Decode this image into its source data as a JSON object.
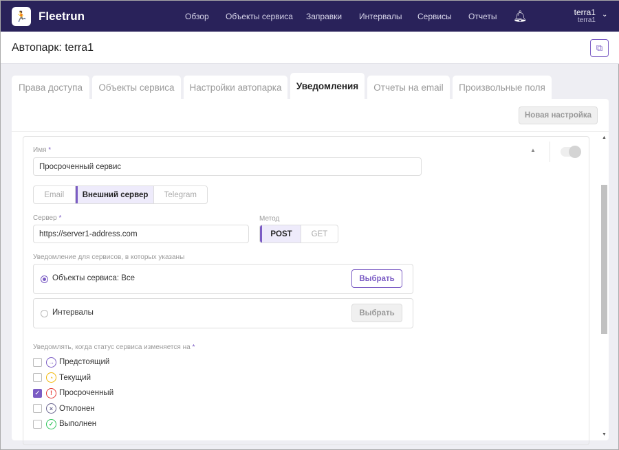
{
  "header": {
    "brand": "Fleetrun",
    "nav": [
      "Обзор",
      "Объекты сервиса",
      "Заправки",
      "Интервалы",
      "Сервисы",
      "Отчеты"
    ],
    "user_name": "terra1",
    "user_sub": "terra1"
  },
  "page_title": "Автопарк: terra1",
  "tabs": [
    "Права доступа",
    "Объекты сервиса",
    "Настройки автопарка",
    "Уведомления",
    "Отчеты на email",
    "Произвольные поля"
  ],
  "new_setting": "Новая настройка",
  "form": {
    "name_label": "Имя",
    "required": "*",
    "name_value": "Просроченный сервис",
    "channels": [
      "Email",
      "Внешний сервер",
      "Telegram"
    ],
    "server_label": "Сервер",
    "server_value": "https://server1-address.com",
    "method_label": "Метод",
    "methods": [
      "POST",
      "GET"
    ],
    "scope_label": "Уведомление для сервисов, в которых указаны",
    "scope_options": [
      {
        "label": "Объекты сервиса: Все",
        "selected": true
      },
      {
        "label": "Интервалы",
        "selected": false
      }
    ],
    "pick": "Выбрать",
    "status_label": "Уведомлять, когда статус сервиса изменяется на",
    "statuses": [
      {
        "label": "Предстоящий",
        "checked": false,
        "icon": "→",
        "color": "#7b5cc4"
      },
      {
        "label": "Текущий",
        "checked": false,
        "icon": "◔",
        "color": "#f2b705"
      },
      {
        "label": "Просроченный",
        "checked": true,
        "icon": "!",
        "color": "#e53935"
      },
      {
        "label": "Отклонен",
        "checked": false,
        "icon": "×",
        "color": "#6a6590"
      },
      {
        "label": "Выполнен",
        "checked": false,
        "icon": "✓",
        "color": "#2ec55a"
      }
    ]
  }
}
